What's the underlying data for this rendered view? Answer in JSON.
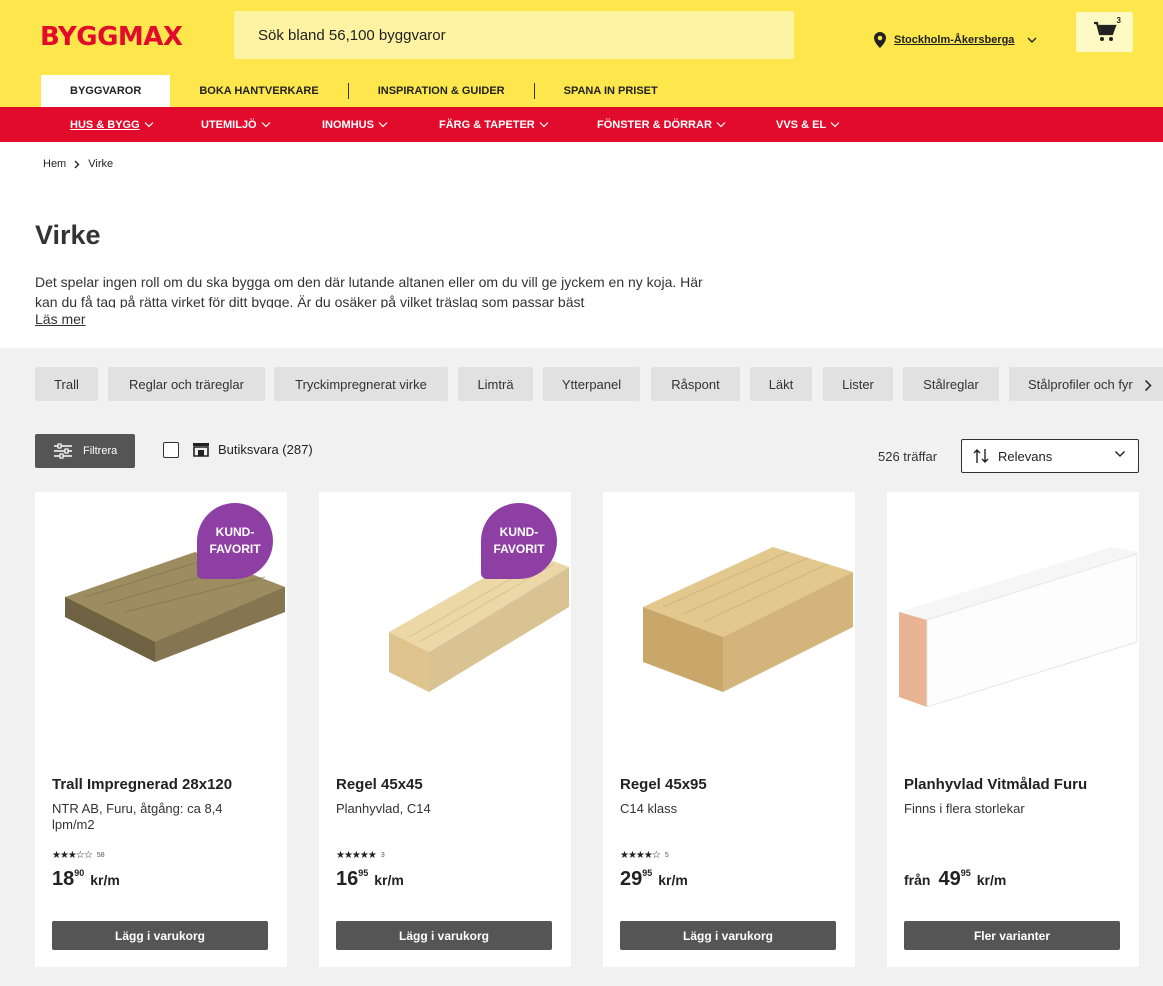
{
  "header": {
    "logo": "BYGGMAX",
    "search_placeholder": "Sök bland 56,100 byggvaror",
    "store": "Stockholm-Åkersberga",
    "cart_count": "3"
  },
  "tabs": [
    {
      "label": "BYGGVAROR"
    },
    {
      "label": "BOKA HANTVERKARE"
    },
    {
      "label": "INSPIRATION & GUIDER"
    },
    {
      "label": "SPANA IN PRISET"
    }
  ],
  "categories": [
    {
      "label": "HUS & BYGG"
    },
    {
      "label": "UTEMILJÖ"
    },
    {
      "label": "INOMHUS"
    },
    {
      "label": "FÄRG & TAPETER"
    },
    {
      "label": "FÖNSTER & DÖRRAR"
    },
    {
      "label": "VVS & EL"
    }
  ],
  "breadcrumb": {
    "home": "Hem",
    "current": "Virke"
  },
  "page": {
    "title": "Virke",
    "intro": "Det spelar ingen roll om du ska bygga om den där lutande altanen eller om du vill ge jyckem en ny koja. Här kan du få tag på rätta virket för ditt bygge. Är du osäker på vilket träslag som passar bäst",
    "read_more": "Läs mer"
  },
  "chips": [
    {
      "label": "Trall"
    },
    {
      "label": "Reglar och träreglar"
    },
    {
      "label": "Tryckimpregnerat virke"
    },
    {
      "label": "Limträ"
    },
    {
      "label": "Ytterpanel"
    },
    {
      "label": "Råspont"
    },
    {
      "label": "Läkt"
    },
    {
      "label": "Lister"
    },
    {
      "label": "Stålreglar"
    },
    {
      "label": "Stålprofiler och fyr"
    }
  ],
  "toolbar": {
    "filter_label": "Filtrera",
    "stock_label": "Butiksvara (287)",
    "hits": "526 träffar",
    "sort_label": "Relevans"
  },
  "products": [
    {
      "title": "Trall Impregnerad 28x120",
      "subtitle": "NTR AB, Furu, åtgång: ca 8,4 lpm/m2",
      "stars": "★★★☆☆",
      "rating_value": 3,
      "rating_count": "58",
      "price_from": "",
      "price_int": "18",
      "price_dec": "90",
      "unit": "kr/m",
      "badge_line1": "KUND-",
      "badge_line2": "FAVORIT",
      "button": "Lägg i varukorg",
      "image_color": "#8a7a52"
    },
    {
      "title": "Regel 45x45",
      "subtitle": "Planhyvlad, C14",
      "stars": "★★★★★",
      "rating_value": 5,
      "rating_count": "3",
      "price_from": "",
      "price_int": "16",
      "price_dec": "95",
      "unit": "kr/m",
      "badge_line1": "KUND-",
      "badge_line2": "FAVORIT",
      "button": "Lägg i varukorg",
      "image_color": "#e8d3a0"
    },
    {
      "title": "Regel 45x95",
      "subtitle": "C14 klass",
      "stars": "★★★★☆",
      "rating_value": 4,
      "rating_count": "5",
      "price_from": "",
      "price_int": "29",
      "price_dec": "95",
      "unit": "kr/m",
      "badge_line1": "",
      "badge_line2": "",
      "button": "Lägg i varukorg",
      "image_color": "#dcc08a"
    },
    {
      "title": "Planhyvlad Vitmålad Furu",
      "subtitle": "Finns i flera storlekar",
      "stars": "",
      "rating_value": null,
      "rating_count": "",
      "price_from": "från",
      "price_int": "49",
      "price_dec": "95",
      "unit": "kr/m",
      "badge_line1": "",
      "badge_line2": "",
      "button": "Fler varianter",
      "image_color": "#f4f4f4"
    }
  ],
  "colors": {
    "brand_yellow": "#fde74c",
    "brand_red": "#e30b2c",
    "badge_purple": "#8e3fa4"
  }
}
